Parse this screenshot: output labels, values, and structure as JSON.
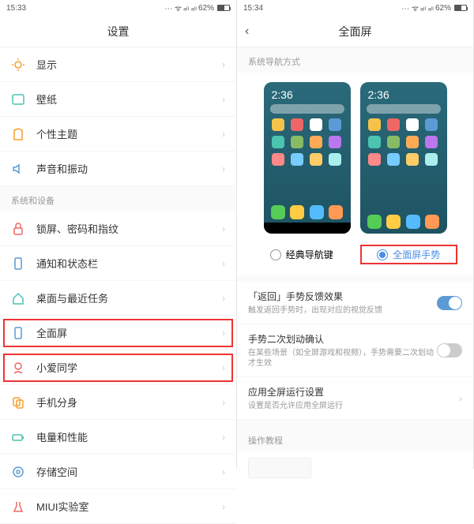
{
  "left": {
    "status": {
      "time": "15:33",
      "battery": "62%"
    },
    "header_title": "设置",
    "sections": {
      "s1": [
        {
          "label": "显示"
        },
        {
          "label": "壁纸"
        },
        {
          "label": "个性主题"
        },
        {
          "label": "声音和振动"
        }
      ],
      "s2_title": "系统和设备",
      "s2": [
        {
          "label": "锁屏、密码和指纹"
        },
        {
          "label": "通知和状态栏"
        },
        {
          "label": "桌面与最近任务"
        },
        {
          "label": "全面屏"
        },
        {
          "label": "小爱同学"
        },
        {
          "label": "手机分身"
        },
        {
          "label": "电量和性能"
        },
        {
          "label": "存储空间"
        },
        {
          "label": "MIUI实验室"
        }
      ]
    }
  },
  "right": {
    "status": {
      "time": "15:34",
      "battery": "62%"
    },
    "header_title": "全面屏",
    "section_nav": "系统导航方式",
    "preview_time": "2:36",
    "nav_options": {
      "classic": "经典导航键",
      "gesture": "全面屏手势"
    },
    "settings": {
      "back_title": "「返回」手势反馈效果",
      "back_sub": "触发返回手势时，出现对应的视觉反馈",
      "confirm_title": "手势二次划动确认",
      "confirm_sub": "在某些场景（如全屏游戏和视频），手势需要二次划动才生效",
      "fullscreen_title": "应用全屏运行设置",
      "fullscreen_sub": "设置是否允许应用全屏运行"
    },
    "tutorial_title": "操作教程"
  }
}
